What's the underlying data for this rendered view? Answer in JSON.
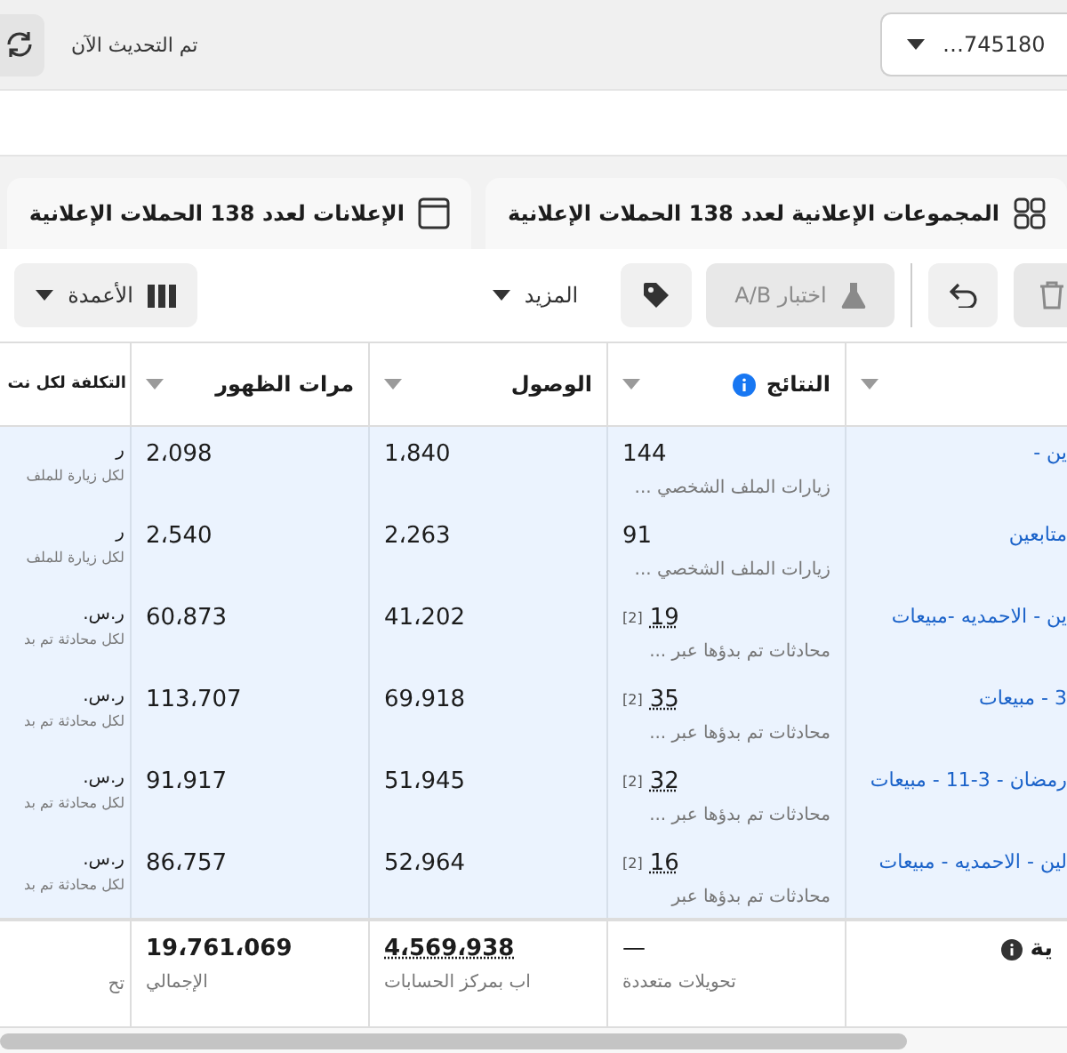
{
  "top_bar": {
    "account_selector": {
      "value": "…745180"
    },
    "refresh_status": "تم التحديث الآن"
  },
  "tabs": [
    {
      "kind": "adsets",
      "label": "المجموعات الإعلانية لعدد 138 الحملات الإعلانية",
      "selected": false
    },
    {
      "kind": "ads",
      "label": "الإعلانات لعدد 138 الحملات الإعلانية",
      "selected": false
    }
  ],
  "toolbar": [
    {
      "kind": "delete",
      "disabled": true
    },
    {
      "kind": "undo",
      "disabled": false
    },
    {
      "kind": "ab_test",
      "label": "اختبار A/B",
      "disabled": true
    },
    {
      "kind": "tag",
      "disabled": false
    },
    {
      "kind": "more",
      "label": "المزيد",
      "disabled": false
    },
    {
      "kind": "columns",
      "label": "الأعمدة",
      "disabled": false
    }
  ],
  "table": {
    "columns": [
      {
        "caret": true
      },
      {
        "label": "النتائج",
        "info": true,
        "caret": true
      },
      {
        "label": "الوصول",
        "caret": true
      },
      {
        "label": "مرات الظهور",
        "caret": true
      },
      {
        "label": "التكلفة لكل نت",
        "caret": false
      }
    ],
    "rows": [
      {
        "selected": true,
        "name": "ين -",
        "results": {
          "value": "144",
          "sub": "زيارات الملف الشخصي ..."
        },
        "reach": "1،840",
        "impressions": "2،098",
        "cost": {
          "value": "ر",
          "sub": "لكل زيارة للملف"
        }
      },
      {
        "selected": true,
        "name": "متابعين",
        "results": {
          "value": "91",
          "sub": "زيارات الملف الشخصي ..."
        },
        "reach": "2،263",
        "impressions": "2،540",
        "cost": {
          "value": "ر",
          "sub": "لكل زيارة للملف"
        }
      },
      {
        "selected": true,
        "name": "ين - الاحمديه -مبيعات",
        "results": {
          "value": "19",
          "note": "[2]",
          "sub": "محادثات تم بدؤها عبر ..."
        },
        "reach": "41،202",
        "impressions": "60،873",
        "cost": {
          "value": "ر.س.",
          "sub": "لكل محادثة تم بد"
        }
      },
      {
        "selected": true,
        "name": "3 - مبيعات",
        "results": {
          "value": "35",
          "note": "[2]",
          "sub": "محادثات تم بدؤها عبر ..."
        },
        "reach": "69،918",
        "impressions": "113،707",
        "cost": {
          "value": "ر.س.",
          "sub": "لكل محادثة تم بد"
        }
      },
      {
        "selected": true,
        "name": "رمضان - 3-11 - مبيعات",
        "results": {
          "value": "32",
          "note": "[2]",
          "sub": "محادثات تم بدؤها عبر ..."
        },
        "reach": "51،945",
        "impressions": "91،917",
        "cost": {
          "value": "ر.س.",
          "sub": "لكل محادثة تم بد"
        }
      },
      {
        "selected": true,
        "name": "لين - الاحمديه - مبيعات",
        "results": {
          "value": "16",
          "note": "[2]",
          "sub": "محادثات تم بدؤها عبر"
        },
        "reach": "52،964",
        "impressions": "86،757",
        "cost": {
          "value": "ر.س.",
          "sub": "لكل محادثة تم بد"
        }
      }
    ],
    "totals": {
      "name": "ية",
      "results": {
        "value": "—",
        "sub": "تحويلات متعددة"
      },
      "reach": {
        "value": "4،569،938",
        "sub": "اب بمركز الحسابات"
      },
      "impressions": {
        "value": "19،761،069",
        "sub": "الإجمالي"
      },
      "cost": {
        "sub": "تح"
      }
    }
  }
}
